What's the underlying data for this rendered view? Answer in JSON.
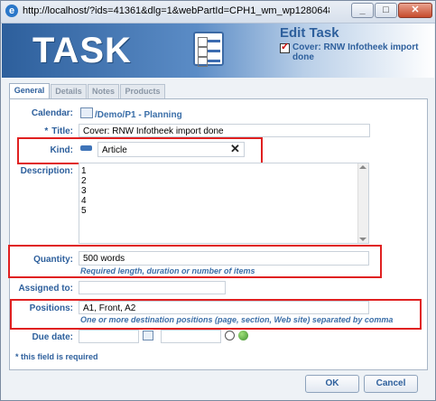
{
  "window": {
    "url": "http://localhost/?ids=41361&dlg=1&webPartId=CPH1_wm_wp1280648340_wp20363..."
  },
  "header": {
    "logo_text": "TASK",
    "title": "Edit Task",
    "subtitle": "Cover: RNW Infotheek import done"
  },
  "tabs": [
    "General",
    "Details",
    "Notes",
    "Products"
  ],
  "form": {
    "calendar_label": "Calendar:",
    "calendar_value": "/Demo/P1 - Planning",
    "title_label": "Title:",
    "title_value": "Cover: RNW Infotheek import done",
    "kind_label": "Kind:",
    "kind_value": "Article",
    "description_label": "Description:",
    "description_lines": [
      "1",
      "2",
      "3",
      "4",
      "5"
    ],
    "quantity_label": "Quantity:",
    "quantity_value": "500 words",
    "quantity_hint": "Required length, duration or number of items",
    "assigned_label": "Assigned to:",
    "assigned_value": "",
    "positions_label": "Positions:",
    "positions_value": "A1, Front, A2",
    "positions_hint": "One or more destination positions (page, section, Web site) separated by comma",
    "due_label": "Due date:",
    "required_note": "* this field is required",
    "required_star": "*"
  },
  "buttons": {
    "ok": "OK",
    "cancel": "Cancel"
  },
  "colors": {
    "accent": "#2d5f9c",
    "highlight": "#e02020"
  }
}
